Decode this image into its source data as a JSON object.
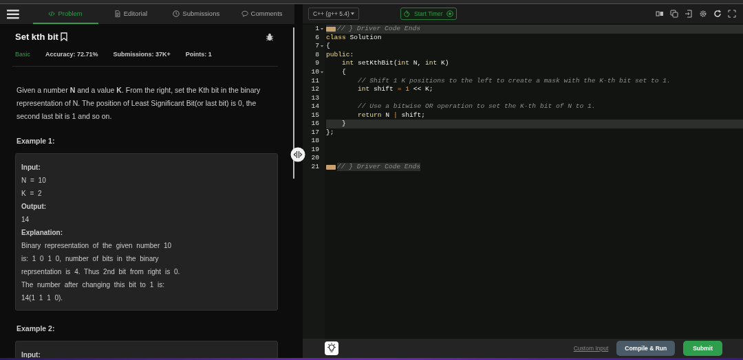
{
  "tabs": [
    {
      "label": "Problem",
      "selected": true
    },
    {
      "label": "Editorial",
      "selected": false
    },
    {
      "label": "Submissions",
      "selected": false
    },
    {
      "label": "Comments",
      "selected": false
    }
  ],
  "problem": {
    "title": "Set kth bit",
    "difficulty": "Basic",
    "accuracy": "Accuracy: 72.71%",
    "submissions": "Submissions: 37K+",
    "points": "Points: 1",
    "description": "Given a number **N** and a value **K**. From the right, set the Kth bit in the binary representation of N. The position of Least Significant Bit(or last bit) is 0, the second last bit is 1 and so on.",
    "examples": [
      {
        "heading": "Example 1:",
        "lines": [
          {
            "kind": "label",
            "text": "Input:"
          },
          {
            "kind": "value",
            "text": "N = 10"
          },
          {
            "kind": "value",
            "text": "K = 2"
          },
          {
            "kind": "label",
            "text": "Output:"
          },
          {
            "kind": "value",
            "text": "14"
          },
          {
            "kind": "label",
            "text": "Explanation:"
          },
          {
            "kind": "value",
            "text": "Binary representation of the given number 10 is: 1 0 1 0, number of bits in the binary reprsentation is 4. Thus 2nd bit from right is 0. The number after changing this bit to 1 is: 14(1 1 1 0)."
          }
        ]
      },
      {
        "heading": "Example 2:",
        "lines": [
          {
            "kind": "label",
            "text": "Input:"
          }
        ]
      }
    ]
  },
  "editor": {
    "language": "C++ (g++ 5.4)",
    "timer": "Start Timer",
    "lines": [
      {
        "num": "1",
        "fold": true,
        "kind": "folded",
        "active": true,
        "tokens": [
          {
            "kind": "comment",
            "text": "// } Driver Code Ends"
          }
        ]
      },
      {
        "num": "6",
        "fold": false,
        "kind": "code",
        "active": false,
        "tokens": [
          {
            "kind": "keyword",
            "text": "class "
          },
          {
            "kind": "plain",
            "text": "Solution"
          }
        ]
      },
      {
        "num": "7",
        "fold": true,
        "kind": "code",
        "active": false,
        "tokens": [
          {
            "kind": "plain",
            "text": "{"
          }
        ]
      },
      {
        "num": "8",
        "fold": false,
        "kind": "code",
        "active": false,
        "tokens": [
          {
            "kind": "keyword",
            "text": "public"
          },
          {
            "kind": "plain",
            "text": ":"
          }
        ]
      },
      {
        "num": "9",
        "fold": false,
        "kind": "code",
        "active": false,
        "tokens": [
          {
            "kind": "keyword",
            "text": "    int "
          },
          {
            "kind": "plain",
            "text": "setKthBit("
          },
          {
            "kind": "keyword",
            "text": "int "
          },
          {
            "kind": "plain",
            "text": "N, "
          },
          {
            "kind": "keyword",
            "text": "int "
          },
          {
            "kind": "plain",
            "text": "K)"
          }
        ]
      },
      {
        "num": "10",
        "fold": true,
        "kind": "code",
        "active": false,
        "tokens": [
          {
            "kind": "plain",
            "text": "    {"
          }
        ]
      },
      {
        "num": "11",
        "fold": false,
        "kind": "code",
        "active": false,
        "tokens": [
          {
            "kind": "comment",
            "text": "        // Shift 1 K positions to the left to create a mask with the K-th bit set to 1."
          }
        ]
      },
      {
        "num": "12",
        "fold": false,
        "kind": "code",
        "active": false,
        "tokens": [
          {
            "kind": "keyword",
            "text": "        int "
          },
          {
            "kind": "plain",
            "text": "shift "
          },
          {
            "kind": "operator",
            "text": "= 1 "
          },
          {
            "kind": "plain",
            "text": "<< K;"
          }
        ]
      },
      {
        "num": "13",
        "fold": false,
        "kind": "code",
        "active": false
      },
      {
        "num": "14",
        "fold": false,
        "kind": "code",
        "active": false,
        "tokens": [
          {
            "kind": "comment",
            "text": "        // Use a bitwise OR operation to set the K-th bit of N to 1."
          }
        ]
      },
      {
        "num": "15",
        "fold": false,
        "kind": "code",
        "active": false,
        "tokens": [
          {
            "kind": "keyword",
            "text": "        return "
          },
          {
            "kind": "plain",
            "text": "N "
          },
          {
            "kind": "operator",
            "text": "| "
          },
          {
            "kind": "plain",
            "text": "shift;"
          }
        ]
      },
      {
        "num": "16",
        "fold": false,
        "kind": "code",
        "active": true,
        "tokens": [
          {
            "kind": "plain",
            "text": "    }"
          }
        ]
      },
      {
        "num": "17",
        "fold": false,
        "kind": "code",
        "active": false,
        "tokens": [
          {
            "kind": "plain",
            "text": "};"
          }
        ]
      },
      {
        "num": "18",
        "fold": false,
        "kind": "code",
        "active": false
      },
      {
        "num": "19",
        "fold": false,
        "kind": "code",
        "active": false
      },
      {
        "num": "20",
        "fold": false,
        "kind": "code",
        "active": false
      },
      {
        "num": "21",
        "fold": false,
        "kind": "folded",
        "active": false,
        "tokens": [
          {
            "kind": "comment",
            "text": "// } Driver Code Ends"
          }
        ]
      }
    ],
    "custom_input": "Custom Input",
    "compile": "Compile & Run",
    "submit": "Submit"
  }
}
